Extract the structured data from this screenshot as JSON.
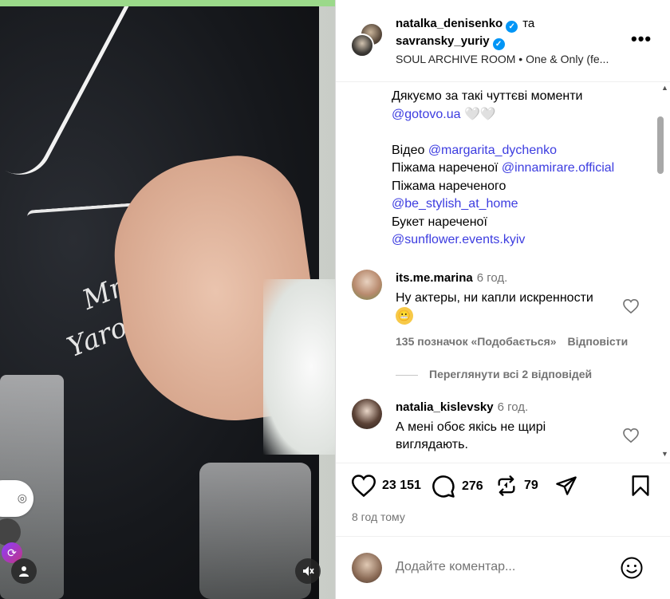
{
  "media": {
    "embroidery_line1": "Mr",
    "embroidery_line2": "Yaroshenko",
    "mute_icon": "speaker-muted-icon",
    "user_tag_icon": "person-icon"
  },
  "header": {
    "user1": "natalka_denisenko",
    "conjunction": "та",
    "user2": "savransky_yuriy",
    "location": "SOUL ARCHIVE ROOM • One & Only (fe..."
  },
  "caption": {
    "lines": [
      {
        "text": "Дякуємо за такі чуттєві моменти",
        "link": ""
      },
      {
        "text": "",
        "link": "@gotovo.ua",
        "suffix": " 🤍🤍"
      },
      {
        "text": "",
        "link": ""
      },
      {
        "text": "Відео ",
        "link": "@margarita_dychenko"
      },
      {
        "text": "Піжама нареченої ",
        "link": "@innamirare.official"
      },
      {
        "text": "Піжама нареченого",
        "link": ""
      },
      {
        "text": "",
        "link": "@be_stylish_at_home"
      },
      {
        "text": "Букет нареченої",
        "link": ""
      },
      {
        "text": "",
        "link": "@sunflower.events.kyiv"
      }
    ]
  },
  "comments": [
    {
      "user": "its.me.marina",
      "time": "6 год.",
      "text": "Ну актеры, ни капли искренности",
      "emoji": "😬",
      "likes": "135 позначок «Подобається»",
      "reply": "Відповісти",
      "view_replies": "Переглянути всі 2 відповідей"
    },
    {
      "user": "natalia_kislevsky",
      "time": "6 год.",
      "text": "А мені обоє якісь не щирі виглядають."
    }
  ],
  "actions": {
    "likes": "23 151",
    "comments": "276",
    "reposts": "79",
    "time_ago": "8 год тому"
  },
  "add_comment": {
    "placeholder": "Додайте коментар..."
  }
}
